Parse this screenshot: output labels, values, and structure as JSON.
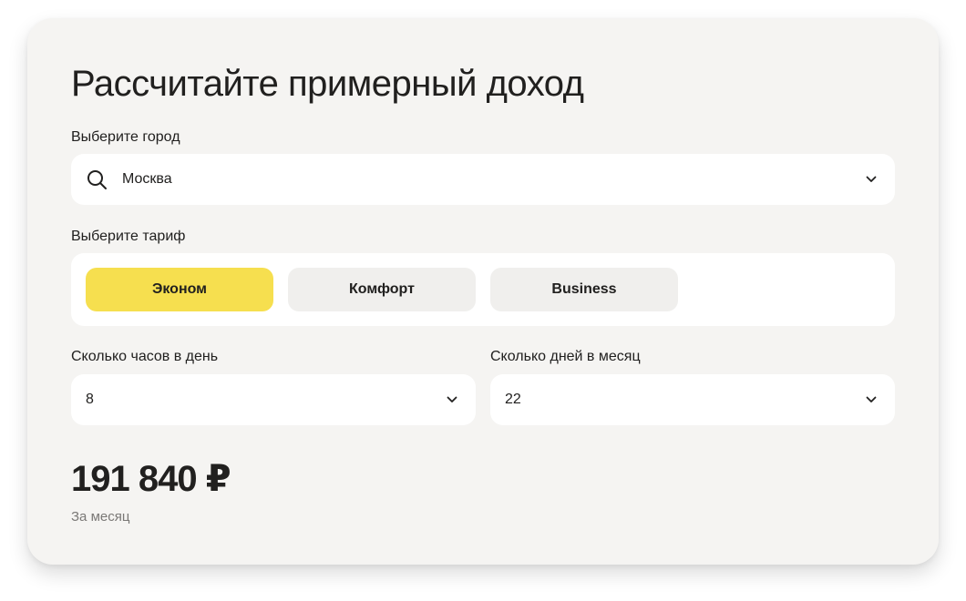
{
  "title": "Рассчитайте примерный доход",
  "city": {
    "label": "Выберите город",
    "value": "Москва",
    "search_icon": "search-icon",
    "dropdown_icon": "chevron-down-icon"
  },
  "tariff": {
    "label": "Выберите тариф",
    "options": [
      "Эконом",
      "Комфорт",
      "Business"
    ],
    "selected": "Эконом",
    "accent_color": "#f6df4f"
  },
  "hours": {
    "label": "Сколько часов в день",
    "value": "8"
  },
  "days": {
    "label": "Сколько дней в месяц",
    "value": "22"
  },
  "result": {
    "amount": "191 840 ₽",
    "period": "За месяц"
  }
}
